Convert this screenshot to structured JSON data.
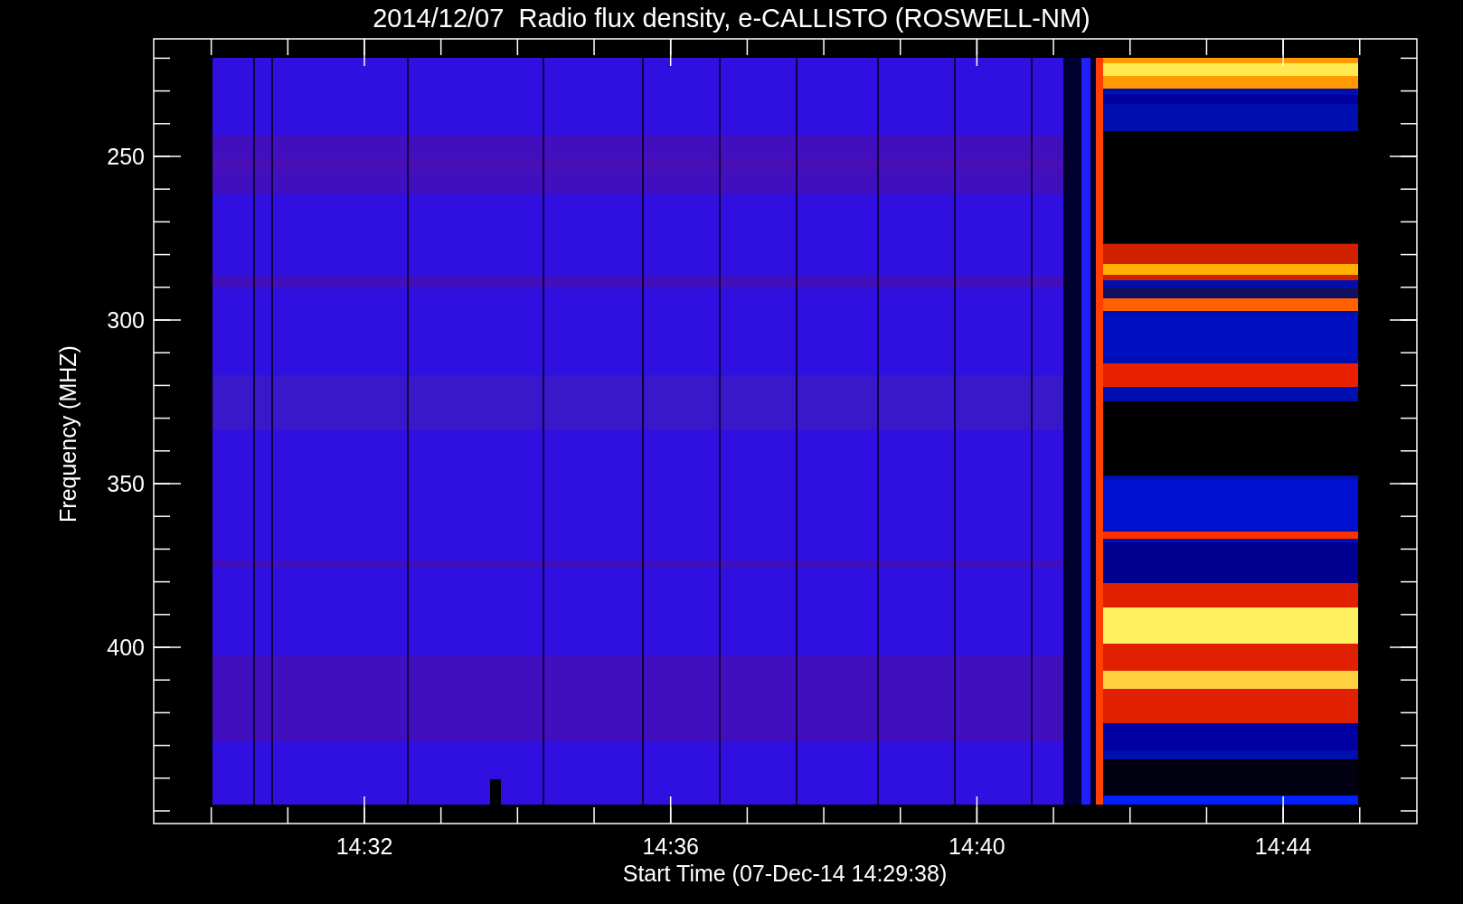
{
  "title": "2014/12/07  Radio flux density, e-CALLISTO (ROSWELL-NM)",
  "plot": {
    "ylabel": "Frequency (MHZ)",
    "xlabel": "Start Time (07-Dec-14 14:29:38)",
    "yticks": [
      "250",
      "300",
      "350",
      "400"
    ],
    "xticks": [
      "14:32",
      "14:36",
      "14:40",
      "14:44"
    ]
  }
}
